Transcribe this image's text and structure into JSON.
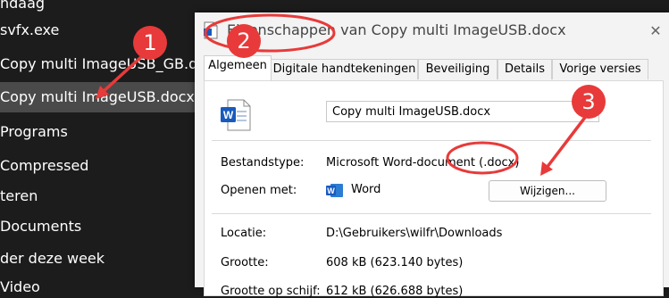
{
  "explorer": {
    "items": [
      {
        "label": "ndaag"
      },
      {
        "label": "svfx.exe"
      },
      {
        "label": "Copy multi ImageUSB_GB.docx"
      },
      {
        "label": "Copy multi ImageUSB.docx"
      },
      {
        "label": "Programs"
      },
      {
        "label": "Compressed"
      },
      {
        "label": "teren"
      },
      {
        "label": "Documents"
      },
      {
        "label": "der deze week"
      },
      {
        "label": "Video"
      }
    ]
  },
  "dialog": {
    "title": "Eigenschappen van Copy multi ImageUSB.docx",
    "close_glyph": "✕",
    "tabs": [
      "Algemeen",
      "Digitale handtekeningen",
      "Beveiliging",
      "Details",
      "Vorige versies"
    ],
    "filename": "Copy multi ImageUSB.docx",
    "rows": {
      "type_label": "Bestandstype:",
      "type_value": "Microsoft Word-document (.docx)",
      "open_label": "Openen met:",
      "open_value": "Word",
      "change_button": "Wijzigen...",
      "location_label": "Locatie:",
      "location_value": "D:\\Gebruikers\\wilfr\\Downloads",
      "size_label": "Grootte:",
      "size_value": "608 kB (623.140 bytes)",
      "disk_size_label": "Grootte op schijf:",
      "disk_size_value": "612 kB (626.688 bytes)"
    }
  },
  "annotations": {
    "markers": [
      "1",
      "2",
      "3"
    ],
    "color": "#e83a3a"
  },
  "colors": {
    "dark_bg": "#1c1c1c",
    "selected_bg": "#4a4a4a",
    "word_blue": "#185abd"
  }
}
